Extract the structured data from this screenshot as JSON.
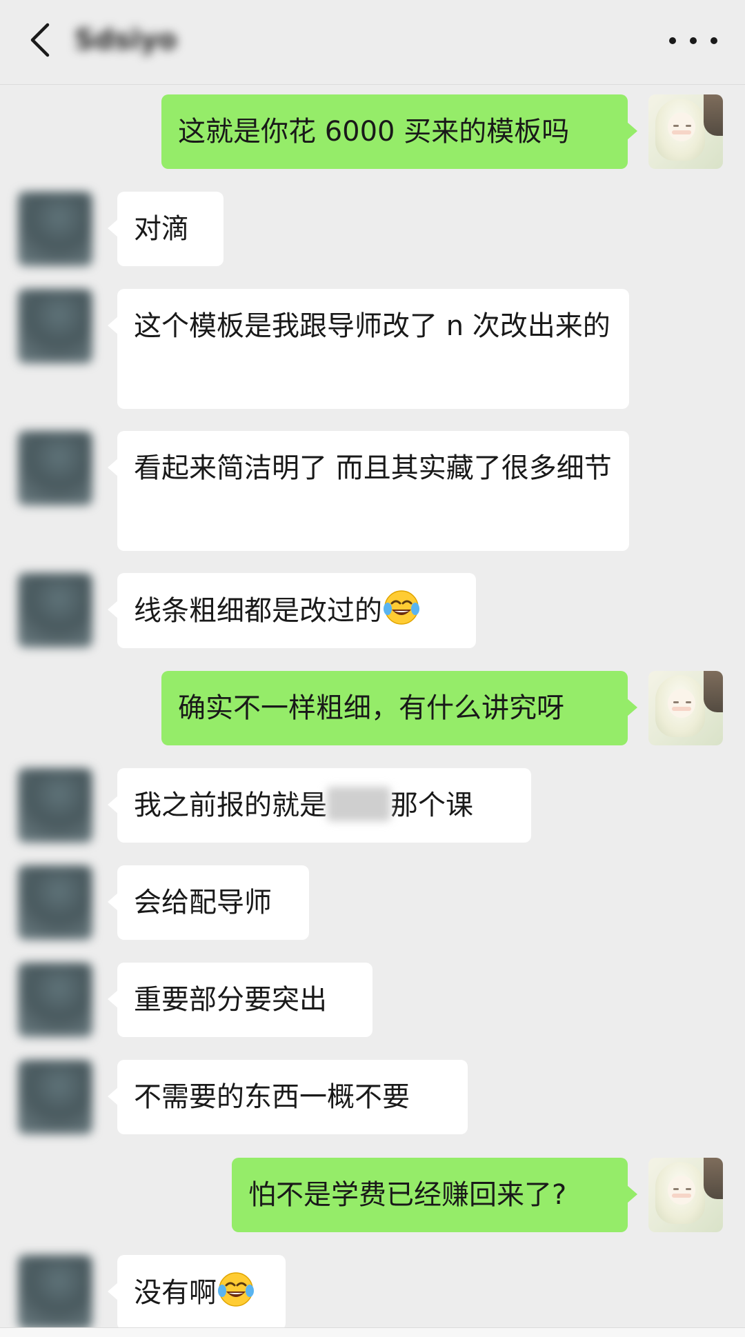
{
  "header": {
    "title": "Sdsiyo",
    "back_icon": "chevron-left-icon",
    "more_icon": "more-horizontal-icon"
  },
  "messages": [
    {
      "side": "right",
      "segments": [
        {
          "type": "text",
          "value": "这就是你花 6000 买来的模板吗"
        }
      ]
    },
    {
      "side": "left",
      "segments": [
        {
          "type": "text",
          "value": "对滴"
        }
      ]
    },
    {
      "side": "left",
      "segments": [
        {
          "type": "text",
          "value": "这个模板是我跟导师改了 n 次改出来的"
        }
      ]
    },
    {
      "side": "left",
      "segments": [
        {
          "type": "text",
          "value": "看起来简洁明了 而且其实藏了很多细节"
        }
      ]
    },
    {
      "side": "left",
      "segments": [
        {
          "type": "text",
          "value": "线条粗细都是改过的"
        },
        {
          "type": "emoji",
          "value": "tears-of-joy"
        }
      ]
    },
    {
      "side": "right",
      "segments": [
        {
          "type": "text",
          "value": "确实不一样粗细，有什么讲究呀"
        }
      ]
    },
    {
      "side": "left",
      "segments": [
        {
          "type": "text",
          "value": "我之前报的就是"
        },
        {
          "type": "redacted"
        },
        {
          "type": "text",
          "value": "那个课"
        }
      ]
    },
    {
      "side": "left",
      "segments": [
        {
          "type": "text",
          "value": "会给配导师"
        }
      ]
    },
    {
      "side": "left",
      "segments": [
        {
          "type": "text",
          "value": "重要部分要突出"
        }
      ]
    },
    {
      "side": "left",
      "segments": [
        {
          "type": "text",
          "value": "不需要的东西一概不要"
        }
      ]
    },
    {
      "side": "right",
      "segments": [
        {
          "type": "text",
          "value": "怕不是学费已经赚回来了?"
        }
      ]
    },
    {
      "side": "left",
      "segments": [
        {
          "type": "text",
          "value": "没有啊"
        },
        {
          "type": "emoji",
          "value": "tears-of-joy"
        }
      ]
    }
  ],
  "colors": {
    "background": "#ededed",
    "bubble_self": "#95ec69",
    "bubble_other": "#ffffff"
  }
}
